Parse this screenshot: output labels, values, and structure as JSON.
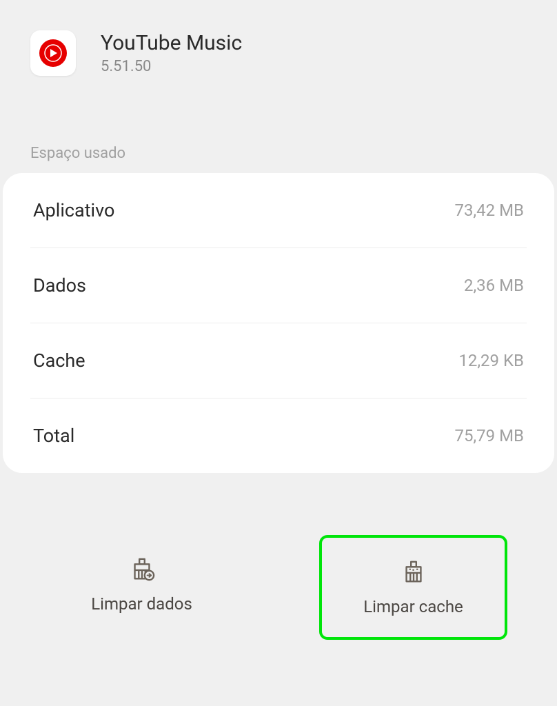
{
  "app": {
    "name": "YouTube Music",
    "version": "5.51.50",
    "icon_accent": "#e60000"
  },
  "section": {
    "title": "Espaço usado"
  },
  "storage": {
    "rows": [
      {
        "label": "Aplicativo",
        "value": "73,42 MB"
      },
      {
        "label": "Dados",
        "value": "2,36 MB"
      },
      {
        "label": "Cache",
        "value": "12,29 KB"
      },
      {
        "label": "Total",
        "value": "75,79 MB"
      }
    ]
  },
  "actions": {
    "clear_data": "Limpar dados",
    "clear_cache": "Limpar cache"
  },
  "colors": {
    "highlight": "#00e50a",
    "icon_stroke": "#6b635a"
  }
}
